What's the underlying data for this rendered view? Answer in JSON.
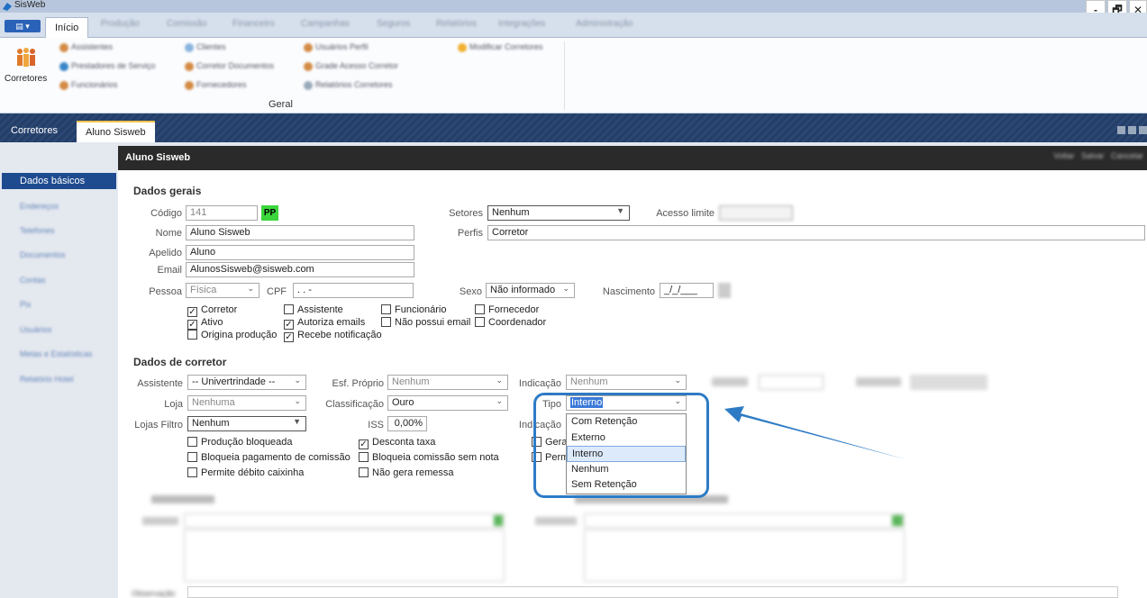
{
  "window": {
    "title": "SisWeb",
    "controls": {
      "minimize": "-",
      "maximize": "❐",
      "close": "✕"
    }
  },
  "ribbon": {
    "active_tab": "Início",
    "blurred_tabs": [
      "Produção",
      "Comissão",
      "Financeiro",
      "Campanhas",
      "Seguros",
      "Relatórios",
      "Integrações",
      "Administração"
    ],
    "big_button_label": "Corretores",
    "group_label": "Geral",
    "items": [
      "Assistentes",
      "Prestadores de Serviço",
      "Funcionários",
      "Clientes",
      "Corretor Documentos",
      "Fornecedores",
      "Usuários Perfil",
      "Grade Acesso Corretor",
      "Relatórios Corretores",
      "Modificar Corretores"
    ]
  },
  "doc_tabs": [
    "Corretores",
    "Aluno Sisweb"
  ],
  "left_nav": {
    "active": "Dados básicos",
    "items": [
      "Endereços",
      "Telefones",
      "Documentos",
      "Contas",
      "Pix",
      "Usuários",
      "Metas e Estatísticas",
      "Relatório Hotel"
    ]
  },
  "panel": {
    "title": "Aluno Sisweb",
    "actions": [
      "Voltar",
      "Salvar",
      "Cancelar"
    ]
  },
  "dados_gerais": {
    "section": "Dados gerais",
    "codigo_label": "Código",
    "codigo_value": "141",
    "pp_badge": "PP",
    "nome_label": "Nome",
    "nome_value": "Aluno Sisweb",
    "apelido_label": "Apelido",
    "apelido_value": "Aluno",
    "email_label": "Email",
    "email_value": "AlunosSisweb@sisweb.com",
    "pessoa_label": "Pessoa",
    "pessoa_value": "Física",
    "cpf_label": "CPF",
    "cpf_value": ". . -",
    "setores_label": "Setores",
    "setores_value": "Nenhum",
    "perfis_label": "Perfis",
    "perfis_value": "Corretor",
    "acesso_label": "Acesso limite",
    "sexo_label": "Sexo",
    "sexo_value": "Não informado",
    "nascimento_label": "Nascimento",
    "nascimento_value": "_/_/___",
    "checkboxes": [
      {
        "label": "Corretor",
        "checked": true
      },
      {
        "label": "Ativo",
        "checked": true
      },
      {
        "label": "Origina produção",
        "checked": false
      },
      {
        "label": "Assistente",
        "checked": false
      },
      {
        "label": "Autoriza emails",
        "checked": true
      },
      {
        "label": "Recebe notificação",
        "checked": true
      },
      {
        "label": "Funcionário",
        "checked": false
      },
      {
        "label": "Não possui email",
        "checked": false
      },
      {
        "label": "Fornecedor",
        "checked": false
      },
      {
        "label": "Coordenador",
        "checked": false
      }
    ]
  },
  "dados_corretor": {
    "section": "Dados de corretor",
    "assistente_label": "Assistente",
    "assistente_value": "-- Univertrindade --",
    "loja_label": "Loja",
    "loja_value": "Nenhuma",
    "lojas_filtro_label": "Lojas Filtro",
    "lojas_filtro_value": "Nenhum",
    "esf_label": "Esf. Próprio",
    "esf_value": "Nenhum",
    "classificacao_label": "Classificação",
    "classificacao_value": "Ouro",
    "iss_label": "ISS",
    "iss_value": "0,00%",
    "indicacao_label": "Indicação",
    "indicacao_value": "Nenhum",
    "tipo_label": "Tipo",
    "tipo_value": "Interno",
    "indicacao2_label": "Indicação",
    "checkboxes": [
      {
        "label": "Produção bloqueada",
        "checked": false
      },
      {
        "label": "Bloqueia pagamento de comissão",
        "checked": false
      },
      {
        "label": "Permite débito caixinha",
        "checked": false
      },
      {
        "label": "Desconta taxa",
        "checked": true
      },
      {
        "label": "Bloqueia comissão sem nota",
        "checked": false
      },
      {
        "label": "Não gera remessa",
        "checked": false
      },
      {
        "label": "Gera",
        "checked": false
      },
      {
        "label": "Perm",
        "checked": false
      }
    ]
  },
  "tipo_dropdown": {
    "options": [
      "Com Retenção",
      "Externo",
      "Interno",
      "Nenhum",
      "Sem Retenção"
    ],
    "selected": "Interno"
  },
  "bottom": {
    "observacao_label": "Observação"
  },
  "colors": {
    "nav_active": "#1e4b8f",
    "highlight": "#2e7bc5",
    "pp_badge": "#3cd63c",
    "tab_band": "#243e67"
  }
}
